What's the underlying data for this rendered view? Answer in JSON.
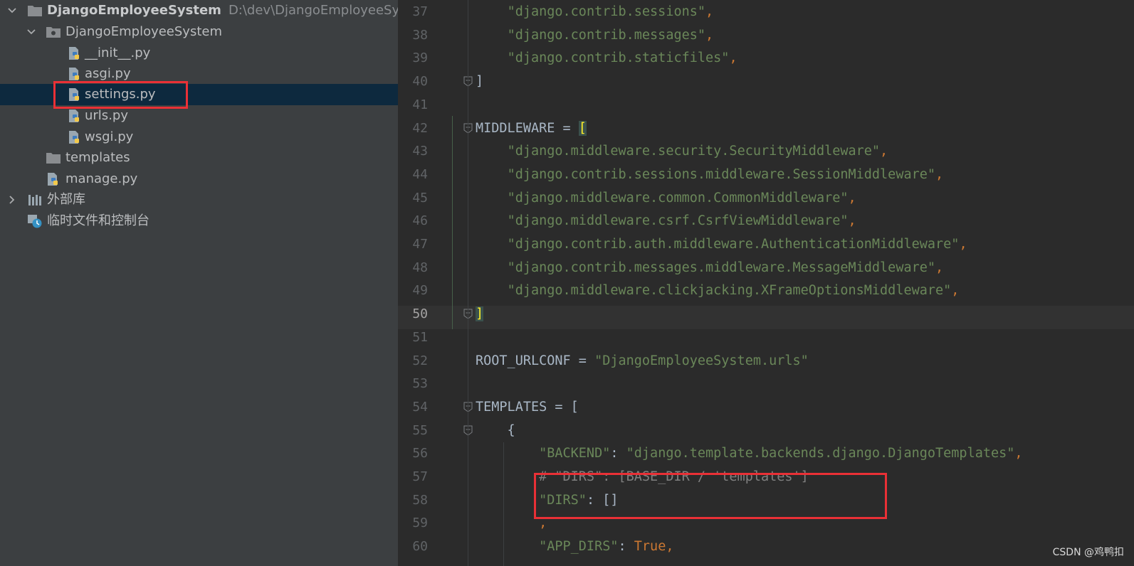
{
  "project_tree": {
    "items": [
      {
        "label": "DjangoEmployeeSystem",
        "path": "D:\\dev\\DjangoEmployeeSystem",
        "icon": "folder-icon"
      },
      {
        "label": "DjangoEmployeeSystem",
        "icon": "package-folder-icon"
      },
      {
        "label": "__init__.py",
        "icon": "python-file-icon"
      },
      {
        "label": "asgi.py",
        "icon": "python-file-icon"
      },
      {
        "label": "settings.py",
        "icon": "python-file-icon",
        "selected": true,
        "highlighted": true
      },
      {
        "label": "urls.py",
        "icon": "python-file-icon"
      },
      {
        "label": "wsgi.py",
        "icon": "python-file-icon"
      },
      {
        "label": "templates",
        "icon": "folder-icon"
      },
      {
        "label": "manage.py",
        "icon": "python-file-icon"
      },
      {
        "label": "外部库",
        "icon": "library-icon"
      },
      {
        "label": "临时文件和控制台",
        "icon": "scratches-icon"
      }
    ]
  },
  "editor": {
    "current_line": "50",
    "lines": [
      {
        "num": "37",
        "tokens": [
          {
            "t": "    "
          },
          {
            "t": "\"django.contrib.sessions\"",
            "c": "s"
          },
          {
            "t": ",",
            "c": "k"
          }
        ]
      },
      {
        "num": "38",
        "tokens": [
          {
            "t": "    "
          },
          {
            "t": "\"django.contrib.messages\"",
            "c": "s"
          },
          {
            "t": ",",
            "c": "k"
          }
        ]
      },
      {
        "num": "39",
        "tokens": [
          {
            "t": "    "
          },
          {
            "t": "\"django.contrib.staticfiles\"",
            "c": "s"
          },
          {
            "t": ",",
            "c": "k"
          }
        ]
      },
      {
        "num": "40",
        "tokens": [
          {
            "t": "]"
          }
        ]
      },
      {
        "num": "41",
        "tokens": []
      },
      {
        "num": "42",
        "tokens": [
          {
            "t": "MIDDLEWARE = "
          },
          {
            "t": "[",
            "c": "br"
          }
        ]
      },
      {
        "num": "43",
        "tokens": [
          {
            "t": "    "
          },
          {
            "t": "\"django.middleware.security.SecurityMiddleware\"",
            "c": "s"
          },
          {
            "t": ",",
            "c": "k"
          }
        ]
      },
      {
        "num": "44",
        "tokens": [
          {
            "t": "    "
          },
          {
            "t": "\"django.contrib.sessions.middleware.SessionMiddleware\"",
            "c": "s"
          },
          {
            "t": ",",
            "c": "k"
          }
        ]
      },
      {
        "num": "45",
        "tokens": [
          {
            "t": "    "
          },
          {
            "t": "\"django.middleware.common.CommonMiddleware\"",
            "c": "s"
          },
          {
            "t": ",",
            "c": "k"
          }
        ]
      },
      {
        "num": "46",
        "tokens": [
          {
            "t": "    "
          },
          {
            "t": "\"django.middleware.csrf.CsrfViewMiddleware\"",
            "c": "s"
          },
          {
            "t": ",",
            "c": "k"
          }
        ]
      },
      {
        "num": "47",
        "tokens": [
          {
            "t": "    "
          },
          {
            "t": "\"django.contrib.auth.middleware.AuthenticationMiddleware\"",
            "c": "s"
          },
          {
            "t": ",",
            "c": "k"
          }
        ]
      },
      {
        "num": "48",
        "tokens": [
          {
            "t": "    "
          },
          {
            "t": "\"django.contrib.messages.middleware.MessageMiddleware\"",
            "c": "s"
          },
          {
            "t": ",",
            "c": "k"
          }
        ]
      },
      {
        "num": "49",
        "tokens": [
          {
            "t": "    "
          },
          {
            "t": "\"django.middleware.clickjacking.XFrameOptionsMiddleware\"",
            "c": "s"
          },
          {
            "t": ",",
            "c": "k"
          }
        ]
      },
      {
        "num": "50",
        "tokens": [
          {
            "t": "]",
            "c": "br"
          }
        ]
      },
      {
        "num": "51",
        "tokens": []
      },
      {
        "num": "52",
        "tokens": [
          {
            "t": "ROOT_URLCONF = "
          },
          {
            "t": "\"DjangoEmployeeSystem.urls\"",
            "c": "s"
          }
        ]
      },
      {
        "num": "53",
        "tokens": []
      },
      {
        "num": "54",
        "tokens": [
          {
            "t": "TEMPLATES = ["
          }
        ]
      },
      {
        "num": "55",
        "tokens": [
          {
            "t": "    {"
          }
        ]
      },
      {
        "num": "56",
        "tokens": [
          {
            "t": "        "
          },
          {
            "t": "\"BACKEND\"",
            "c": "s"
          },
          {
            "t": ": "
          },
          {
            "t": "\"django.template.backends.django.DjangoTemplates\"",
            "c": "s"
          },
          {
            "t": ",",
            "c": "k"
          }
        ]
      },
      {
        "num": "57",
        "tokens": [
          {
            "t": "        "
          },
          {
            "t": "# \"DIRS\": [BASE_DIR / 'templates']",
            "c": "cm"
          }
        ]
      },
      {
        "num": "58",
        "tokens": [
          {
            "t": "        "
          },
          {
            "t": "\"DIRS\"",
            "c": "s"
          },
          {
            "t": ": []"
          }
        ]
      },
      {
        "num": "59",
        "tokens": [
          {
            "t": "        "
          },
          {
            "t": ",",
            "c": "k"
          }
        ]
      },
      {
        "num": "60",
        "tokens": [
          {
            "t": "        "
          },
          {
            "t": "\"APP_DIRS\"",
            "c": "s"
          },
          {
            "t": ": "
          },
          {
            "t": "True",
            "c": "k"
          },
          {
            "t": ",",
            "c": "k"
          }
        ]
      }
    ]
  },
  "watermark": "CSDN @鸡鸭扣",
  "colors": {
    "sidebar_bg": "#3c3f41",
    "editor_bg": "#2b2b2b",
    "selection": "#0d293e",
    "string": "#6a8759",
    "keyword": "#cc7832",
    "comment": "#808080",
    "highlight_box": "#e93036"
  }
}
